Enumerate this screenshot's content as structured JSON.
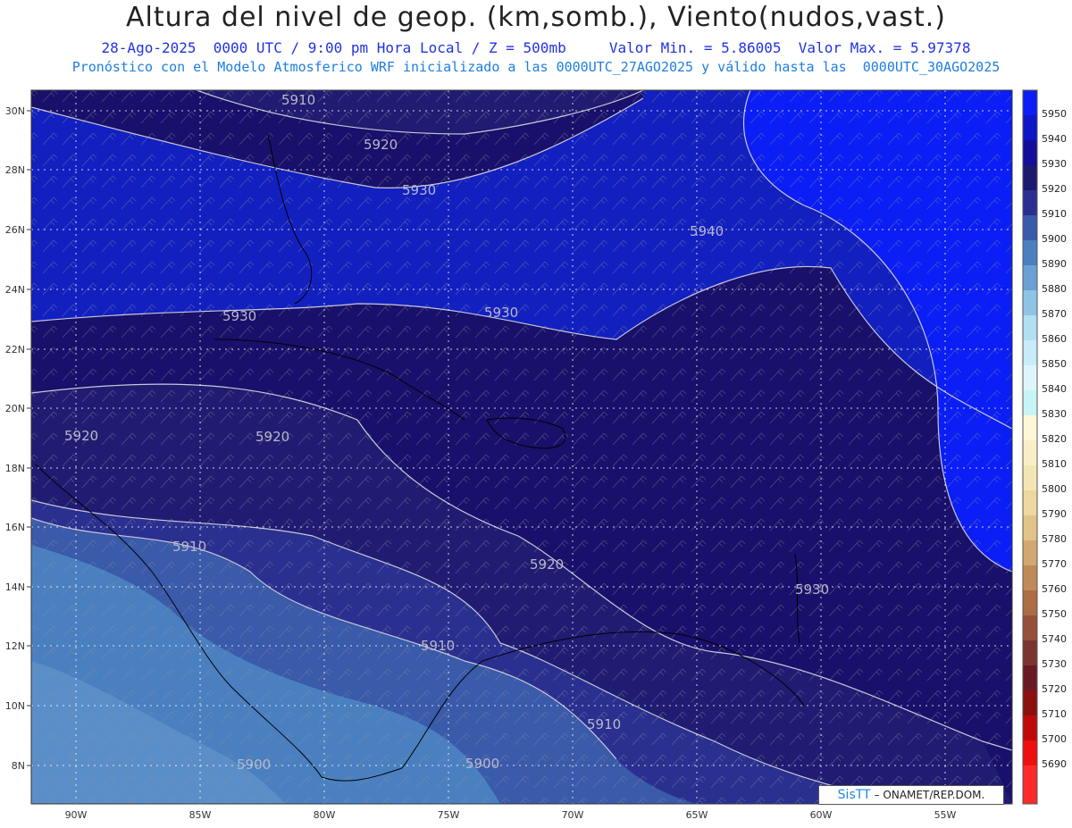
{
  "header": {
    "title": "Altura del nivel de geop. (km,somb.), Viento(nudos,vast.)",
    "line1": "28-Ago-2025  0000 UTC / 9:00 pm Hora Local / Z = 500mb     Valor Min. = 5.86005  Valor Max. = 5.97378",
    "line2": "Pronóstico con el Modelo Atmosferico WRF inicializado a las 0000UTC_27AGO2025 y válido hasta las  0000UTC_30AGO2025"
  },
  "map": {
    "lat_labels": [
      "30N",
      "28N",
      "26N",
      "24N",
      "22N",
      "20N",
      "18N",
      "16N",
      "14N",
      "12N",
      "10N",
      "8N"
    ],
    "lon_labels": [
      "90W",
      "85W",
      "80W",
      "75W",
      "70W",
      "65W",
      "60W",
      "55W"
    ],
    "contour_labels": [
      "5910",
      "5920",
      "5930",
      "5940",
      "5930",
      "5930",
      "5920",
      "5920",
      "5910",
      "5920",
      "5930",
      "5910",
      "5910",
      "5900",
      "5900"
    ]
  },
  "colorbar": {
    "levels": [
      "5950",
      "5940",
      "5930",
      "5920",
      "5910",
      "5900",
      "5890",
      "5880",
      "5870",
      "5860",
      "5850",
      "5840",
      "5830",
      "5820",
      "5810",
      "5800",
      "5790",
      "5780",
      "5770",
      "5760",
      "5750",
      "5740",
      "5730",
      "5720",
      "5710",
      "5700",
      "5690"
    ],
    "colors": [
      "#0a1ef5",
      "#0d17c8",
      "#140e9a",
      "#1c1a6e",
      "#2a3090",
      "#3a5aaa",
      "#4a80c0",
      "#6aa0d4",
      "#8ec4e6",
      "#b0e0f2",
      "#c8ecf8",
      "#dff5fc",
      "#c8f4f8",
      "#fff8d8",
      "#f8efc8",
      "#f4e6b4",
      "#eed8a0",
      "#e2c488",
      "#d2a870",
      "#c08a58",
      "#ac6c44",
      "#96503a",
      "#7c3430",
      "#6a1a22",
      "#8c1010",
      "#c00a0a",
      "#ee1010"
    ],
    "bottom_color": "#ff2a2a"
  },
  "credit": {
    "brand": "SisTT",
    "org": "– ONAMET/REP.DOM."
  }
}
